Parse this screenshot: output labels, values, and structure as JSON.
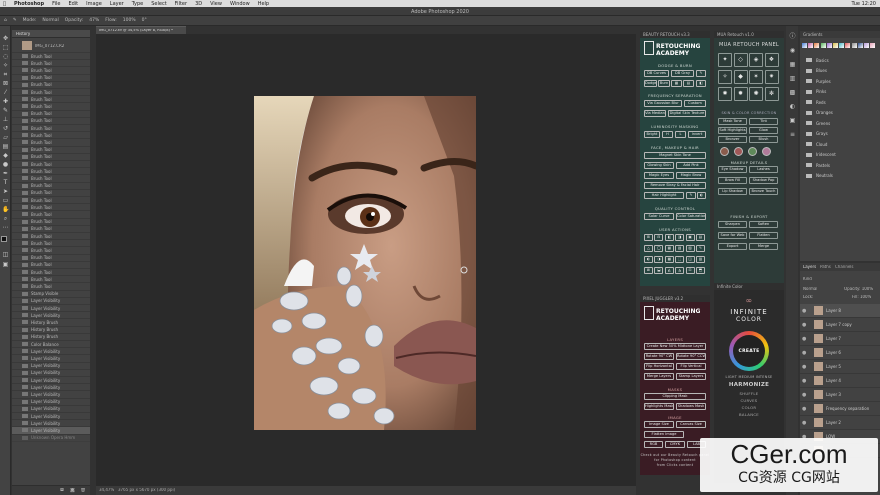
{
  "menubar": {
    "app": "Photoshop",
    "items": [
      "File",
      "Edit",
      "Image",
      "Layer",
      "Type",
      "Select",
      "Filter",
      "3D",
      "View",
      "Window",
      "Help"
    ],
    "time": "Tue 12:20"
  },
  "window": {
    "title": "Adobe Photoshop 2020"
  },
  "options": {
    "mode_label": "Mode:",
    "mode_value": "Normal",
    "opacity_label": "Opacity:",
    "opacity_value": "47%",
    "flow_label": "Flow:",
    "flow_value": "100%",
    "angle_value": "0°"
  },
  "document": {
    "tab": "IMG_0712.tif @ 34,5% (Layer 8, RGB/8) *",
    "zoom": "34,47%",
    "doc_size": "3765 px x 5670 px (300 ppi)"
  },
  "history": {
    "tab": "History",
    "snapshot": "IMG_0712.CR2",
    "items": [
      "Brush Tool",
      "Brush Tool",
      "Brush Tool",
      "Brush Tool",
      "Brush Tool",
      "Brush Tool",
      "Brush Tool",
      "Brush Tool",
      "Brush Tool",
      "Brush Tool",
      "Brush Tool",
      "Brush Tool",
      "Brush Tool",
      "Brush Tool",
      "Brush Tool",
      "Brush Tool",
      "Brush Tool",
      "Brush Tool",
      "Brush Tool",
      "Brush Tool",
      "Brush Tool",
      "Brush Tool",
      "Brush Tool",
      "Brush Tool",
      "Brush Tool",
      "Brush Tool",
      "Brush Tool",
      "Brush Tool",
      "Brush Tool",
      "Brush Tool",
      "Brush Tool",
      "Brush Tool",
      "Brush Tool",
      "Stamp Visible",
      "Layer Visibility",
      "Layer Visibility",
      "Layer Visibility",
      "History Brush",
      "History Brush",
      "History Brush",
      "Color Balance",
      "Layer Visibility",
      "Layer Visibility",
      "Layer Visibility",
      "Layer Visibility",
      "Layer Visibility",
      "Layer Visibility",
      "Layer Visibility",
      "Layer Visibility",
      "Layer Visibility",
      "Layer Visibility",
      "Layer Visibility",
      "Layer Visibility"
    ],
    "last": "Unknown Opera Hmm"
  },
  "beauty": {
    "header": "BEAUTY RETOUCH v3.3",
    "brand1": "RETOUCHING",
    "brand2": "ACADEMY",
    "dodge_burn": "DODGE & BURN",
    "db_buttons": [
      "DB Curves",
      "DB Gray",
      "Dodge",
      "Burn"
    ],
    "freq_sep": "FREQUENCY SEPARATION",
    "fs_buttons": [
      "Via Gaussian Blur",
      "Custom",
      "Via Median",
      "Digital Skin Texture"
    ],
    "lum_mask": "LUMINOSITY MASKING",
    "lum_buttons": [
      "Bright",
      "H",
      "L",
      "Invert"
    ],
    "face": "FACE, MAKEUP & HAIR",
    "face_buttons": [
      "Magnet Skin Tone",
      "Glowing Skin",
      "Add Pink",
      "Magic Eyes",
      "Magic Brow",
      "Remove Stray & Facial Hair",
      "Hair Highlight"
    ],
    "quality": "QUALITY CONTROL",
    "qc_buttons": [
      "Solar Curve",
      "Color Saturation"
    ],
    "user": "USER ACTIONS"
  },
  "mua": {
    "header": "MUA Retouch v1.0",
    "title": "MUA RETOUCH PANEL",
    "sub": "SKIN & COLOR CORRECTION",
    "skin_buttons": [
      "Mask Tone",
      "Tint",
      "Soft Highlights",
      "Glow",
      "Bronzer",
      "Blush",
      "Lipstick",
      "Eyeliner"
    ],
    "makeup_details": "MAKEUP DETAILS",
    "details_buttons": [
      "Eye Shadow",
      "Lashes",
      "Brow Fill",
      "Shadow Pop",
      "Lip Shadow",
      "Bronze Touch"
    ],
    "finish": "FINISH & EXPORT",
    "finish_buttons": [
      "Sharpen",
      "Soften",
      "Save for Web",
      "Flatten",
      "Export",
      "Merge"
    ]
  },
  "pixel": {
    "header": "PIXEL JUGGLER v3.2",
    "brand1": "RETOUCHING",
    "brand2": "ACADEMY",
    "layers": "LAYERS",
    "layer_buttons": [
      "Create New 50% Midtone Layer",
      "Rotate 90° CW",
      "Rotate 90° CCW",
      "Flip Horizontal",
      "Flip Vertical",
      "Merge Layers",
      "Stamp Layers"
    ],
    "masks": "MASKS",
    "mask_buttons": [
      "Clipping Mask",
      "Highlights Mask",
      "Shadows Mask"
    ],
    "image": "IMAGE",
    "image_buttons": [
      "Image Size",
      "Canvas Size",
      "Flatten Image",
      "RGB",
      "CMYK",
      "LAB"
    ],
    "footer1": "Check out our Beauty Retouch panel",
    "footer2": "for Photoshop content",
    "footer3": "from Clicks content"
  },
  "infinite": {
    "header": "Infinite Color",
    "brand1": "INFINITE",
    "brand2": "COLOR",
    "create": "CREATE",
    "sub": "LIGHT MEDIUM INTENSE",
    "harmonize": "HARMONIZE",
    "shuffle": "SHUFFLE",
    "curves": "CURVES",
    "color": "COLOR",
    "balance": "BALANCE"
  },
  "gradients": {
    "tab": "Gradients",
    "folders": [
      "Basics",
      "Blues",
      "Purples",
      "Pinks",
      "Reds",
      "Oranges",
      "Greens",
      "Grays",
      "Cloud",
      "Iridescent",
      "Pastels",
      "Neutrals"
    ]
  },
  "layers": {
    "tabs": [
      "Layers",
      "Paths",
      "Channels"
    ],
    "kind": "Kind",
    "blend": "Normal",
    "opacity": "Opacity: 100%",
    "lock": "Lock:",
    "fill": "Fill: 100%",
    "rows": [
      "Layer 8",
      "Layer 7 copy",
      "Layer 7",
      "Layer 6",
      "Layer 5",
      "Layer 4",
      "Layer 3",
      "Frequency separation",
      "Layer 2",
      "LOW",
      "HIGH"
    ]
  },
  "watermark": {
    "domain": "CGer.com",
    "sub": "CG资源 CG网站"
  },
  "colors": {
    "teal_panel": "#26443f",
    "maroon_panel": "#3a1c24",
    "accent_pink": "#c98e8e"
  }
}
